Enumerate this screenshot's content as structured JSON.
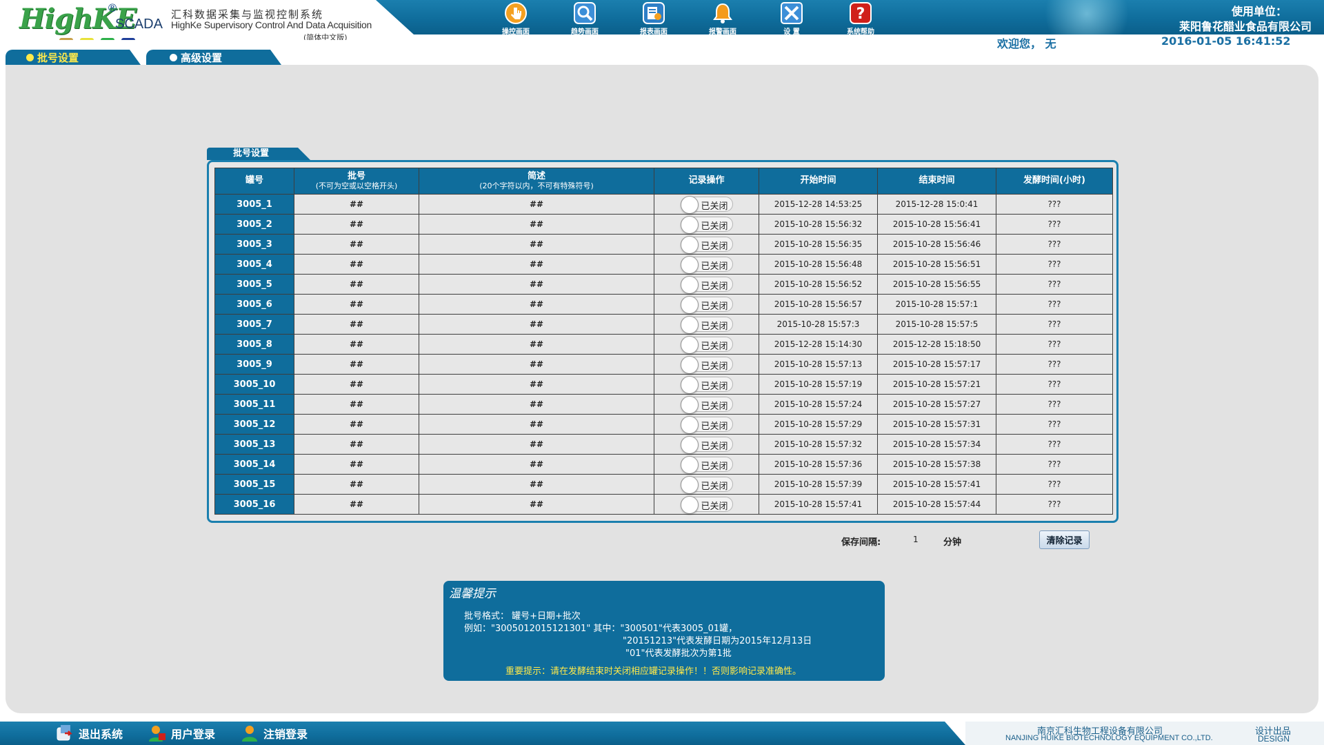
{
  "header": {
    "logo_text": "HighKE",
    "logo_reg": "®",
    "logo_scada": "SCADA",
    "title_cn": "汇科数据采集与监视控制系统",
    "title_en": "HighKe Supervisory Control And Data Acquisition",
    "version": "(简体中文版)",
    "user_unit_label": "使用单位：",
    "user_unit_name": "莱阳鲁花醋业食品有限公司",
    "welcome": "欢迎您，   无",
    "datetime": "2016-01-05   16:41:52",
    "logo_dot_colors": [
      "#c9a24a",
      "#e8e23a",
      "#2db04a",
      "#1f3f9a"
    ]
  },
  "toolbar": [
    {
      "name": "control",
      "label": "操控画面",
      "icon": "hand-pointer-icon",
      "color": "#f4a020"
    },
    {
      "name": "trend",
      "label": "趋势画面",
      "icon": "magnifier-icon",
      "color": "#3c8fd8"
    },
    {
      "name": "report",
      "label": "报表画面",
      "icon": "report-icon",
      "color": "#2d7fc7"
    },
    {
      "name": "alarm",
      "label": "报警画面",
      "icon": "bell-icon",
      "color": "#f49b1c"
    },
    {
      "name": "settings",
      "label": "设    置",
      "icon": "tools-icon",
      "color": "#3c8fd8"
    },
    {
      "name": "help",
      "label": "系统帮助",
      "icon": "help-icon",
      "color": "#d0201a"
    }
  ],
  "tabs": {
    "batch": "批号设置",
    "advanced": "高级设置"
  },
  "panel": {
    "title": "批号设置",
    "columns": [
      {
        "label": "罐号",
        "sub": ""
      },
      {
        "label": "批号",
        "sub": "(不可为空或以空格开头)"
      },
      {
        "label": "简述",
        "sub": "(20个字符以内，不可有特殊符号)"
      },
      {
        "label": "记录操作",
        "sub": ""
      },
      {
        "label": "开始时间",
        "sub": ""
      },
      {
        "label": "结束时间",
        "sub": ""
      },
      {
        "label": "发酵时间(小时)",
        "sub": ""
      }
    ],
    "rows": [
      {
        "tank": "3005_1",
        "batch": "##",
        "desc": "##",
        "record": "已关闭",
        "start": "2015-12-28 14:53:25",
        "end": "2015-12-28 15:0:41",
        "duration": "???"
      },
      {
        "tank": "3005_2",
        "batch": "##",
        "desc": "##",
        "record": "已关闭",
        "start": "2015-10-28 15:56:32",
        "end": "2015-10-28 15:56:41",
        "duration": "???"
      },
      {
        "tank": "3005_3",
        "batch": "##",
        "desc": "##",
        "record": "已关闭",
        "start": "2015-10-28 15:56:35",
        "end": "2015-10-28 15:56:46",
        "duration": "???"
      },
      {
        "tank": "3005_4",
        "batch": "##",
        "desc": "##",
        "record": "已关闭",
        "start": "2015-10-28 15:56:48",
        "end": "2015-10-28 15:56:51",
        "duration": "???"
      },
      {
        "tank": "3005_5",
        "batch": "##",
        "desc": "##",
        "record": "已关闭",
        "start": "2015-10-28 15:56:52",
        "end": "2015-10-28 15:56:55",
        "duration": "???"
      },
      {
        "tank": "3005_6",
        "batch": "##",
        "desc": "##",
        "record": "已关闭",
        "start": "2015-10-28 15:56:57",
        "end": "2015-10-28 15:57:1",
        "duration": "???"
      },
      {
        "tank": "3005_7",
        "batch": "##",
        "desc": "##",
        "record": "已关闭",
        "start": "2015-10-28 15:57:3",
        "end": "2015-10-28 15:57:5",
        "duration": "???"
      },
      {
        "tank": "3005_8",
        "batch": "##",
        "desc": "##",
        "record": "已关闭",
        "start": "2015-12-28 15:14:30",
        "end": "2015-12-28 15:18:50",
        "duration": "???"
      },
      {
        "tank": "3005_9",
        "batch": "##",
        "desc": "##",
        "record": "已关闭",
        "start": "2015-10-28 15:57:13",
        "end": "2015-10-28 15:57:17",
        "duration": "???"
      },
      {
        "tank": "3005_10",
        "batch": "##",
        "desc": "##",
        "record": "已关闭",
        "start": "2015-10-28 15:57:19",
        "end": "2015-10-28 15:57:21",
        "duration": "???"
      },
      {
        "tank": "3005_11",
        "batch": "##",
        "desc": "##",
        "record": "已关闭",
        "start": "2015-10-28 15:57:24",
        "end": "2015-10-28 15:57:27",
        "duration": "???"
      },
      {
        "tank": "3005_12",
        "batch": "##",
        "desc": "##",
        "record": "已关闭",
        "start": "2015-10-28 15:57:29",
        "end": "2015-10-28 15:57:31",
        "duration": "???"
      },
      {
        "tank": "3005_13",
        "batch": "##",
        "desc": "##",
        "record": "已关闭",
        "start": "2015-10-28 15:57:32",
        "end": "2015-10-28 15:57:34",
        "duration": "???"
      },
      {
        "tank": "3005_14",
        "batch": "##",
        "desc": "##",
        "record": "已关闭",
        "start": "2015-10-28 15:57:36",
        "end": "2015-10-28 15:57:38",
        "duration": "???"
      },
      {
        "tank": "3005_15",
        "batch": "##",
        "desc": "##",
        "record": "已关闭",
        "start": "2015-10-28 15:57:39",
        "end": "2015-10-28 15:57:41",
        "duration": "???"
      },
      {
        "tank": "3005_16",
        "batch": "##",
        "desc": "##",
        "record": "已关闭",
        "start": "2015-10-28 15:57:41",
        "end": "2015-10-28 15:57:44",
        "duration": "???"
      }
    ]
  },
  "save": {
    "label": "保存间隔:",
    "value": "1",
    "unit": "分钟",
    "clear_button": "清除记录"
  },
  "tip": {
    "logo": "温馨提示",
    "line1": "批号格式： 罐号+日期+批次",
    "line2": "例如：\"3005012015121301\" 其中：\"300501\"代表3005_01罐，",
    "line3": "\"20151213\"代表发酵日期为2015年12月13日",
    "line4": "\"01\"代表发酵批次为第1批",
    "warning": "重要提示：请在发酵结束时关闭相应罐记录操作！！否则影响记录准确性。"
  },
  "footer": {
    "buttons": [
      {
        "name": "exit",
        "label": "退出系统",
        "icon": "exit-icon"
      },
      {
        "name": "login",
        "label": "用户登录",
        "icon": "user-login-icon"
      },
      {
        "name": "logout",
        "label": "注销登录",
        "icon": "user-logout-icon"
      }
    ],
    "company_cn": "南京汇科生物工程设备有限公司",
    "company_en": "NANJING HUIKE BIOTECHNOLOGY EQUIPMENT CO.,LTD.",
    "design_cn": "设计出品",
    "design_en": "DESIGN"
  }
}
